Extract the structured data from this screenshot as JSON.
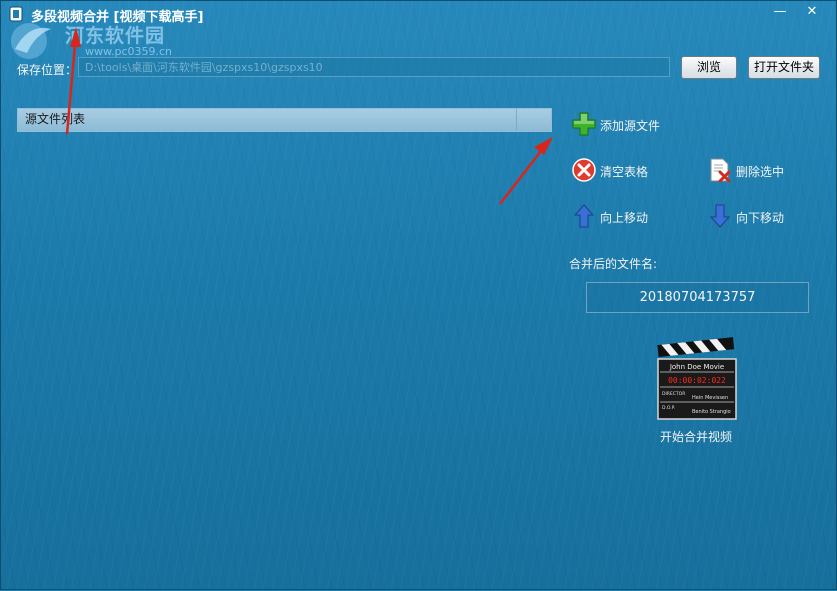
{
  "window": {
    "title": "多段视频合并 [视频下载高手]",
    "minimize_glyph": "—",
    "close_glyph": "✕"
  },
  "watermark": {
    "site_name": "河东软件园",
    "url": "www.pc0359.cn"
  },
  "save_location": {
    "label": "保存位置：",
    "value": "D:\\tools\\桌面\\河东软件园\\gzspxs10\\gzspxs10",
    "browse_label": "浏览",
    "open_folder_label": "打开文件夹"
  },
  "source_list": {
    "header": "源文件列表"
  },
  "actions": {
    "add_label": "添加源文件",
    "clear_label": "清空表格",
    "delete_label": "删除选中",
    "up_label": "向上移动",
    "down_label": "向下移动"
  },
  "merged_name": {
    "label": "合并后的文件名:",
    "value": "20180704173757"
  },
  "start": {
    "label": "开始合并视频",
    "clapper_title": "John Doe Movie",
    "clapper_timecode": "00:00:02:022",
    "clapper_director_label": "DIRECTOR",
    "clapper_director": "Hein Mevissen",
    "clapper_dop_label": "D.O.P.",
    "clapper_dop": "Benito Strangio"
  },
  "icons": {
    "app": "app-icon",
    "add": "plus-icon",
    "clear": "clear-circle-icon",
    "delete": "delete-file-icon",
    "up": "arrow-up-icon",
    "down": "arrow-down-icon",
    "start": "clapperboard-icon"
  },
  "colors": {
    "background": "#1c7fb0",
    "list_header": "#a9cde2",
    "annotation_arrow": "#d9261c"
  }
}
